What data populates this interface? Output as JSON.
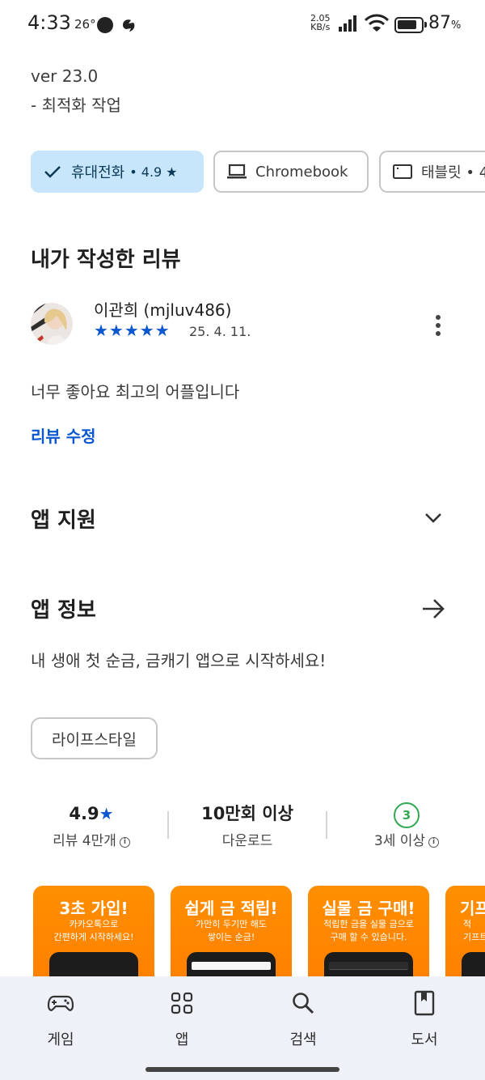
{
  "status_bar": {
    "time": "4:33",
    "temperature": "26°",
    "net_speed_value": "2.05",
    "net_speed_unit": "KB/s",
    "battery_percent": "87",
    "battery_percent_symbol": "%",
    "battery_level": 0.87
  },
  "whats_new": {
    "version": "ver 23.0",
    "note": "- 최적화 작업"
  },
  "device_chips": [
    {
      "label": "휴대전화",
      "rating": "• 4.9 ★",
      "selected": true
    },
    {
      "label": "Chromebook",
      "selected": false
    },
    {
      "label": "태블릿 • 4",
      "selected": false
    }
  ],
  "my_review": {
    "heading": "내가 작성한 리뷰",
    "reviewer": "이관희 (mjluv486)",
    "stars": "★★★★★",
    "star_count": 5,
    "date": "25. 4. 11.",
    "text": "너무 좋아요 최고의 어플입니다",
    "edit_label": "리뷰 수정"
  },
  "app_support": {
    "heading": "앱 지원"
  },
  "app_info": {
    "heading": "앱 정보",
    "description": "내 생애 첫 순금, 금캐기 앱으로 시작하세요!",
    "category_tag": "라이프스타일"
  },
  "stats": {
    "rating_value": "4.9",
    "rating_star": "★",
    "rating_label": "리뷰 4만개",
    "downloads_value": "10만회 이상",
    "downloads_label": "다운로드",
    "age_badge": "3",
    "age_label": "3세 이상"
  },
  "screenshots": [
    {
      "title": "3초 가입!",
      "line1": "카카오톡으로",
      "line2": "간편하게 시작하세요!"
    },
    {
      "title": "쉽게 금 적립!",
      "line1": "가만히 두기만 해도",
      "line2": "쌓이는 순금!"
    },
    {
      "title": "실물 금 구매!",
      "line1": "적립한 금을 실물 금으로",
      "line2": "구매 할 수 있습니다."
    },
    {
      "title": "기프",
      "line1": "적",
      "line2": "기프트"
    }
  ],
  "bottom_nav": {
    "games": "게임",
    "apps": "앱",
    "search": "검색",
    "books": "도서"
  },
  "colors": {
    "accent_blue": "#0b57d0",
    "chip_selected_bg": "#c7e6fb",
    "nav_bg": "#eef2f8",
    "age_green": "#34a853",
    "screenshot_orange": "#ff8f00"
  }
}
